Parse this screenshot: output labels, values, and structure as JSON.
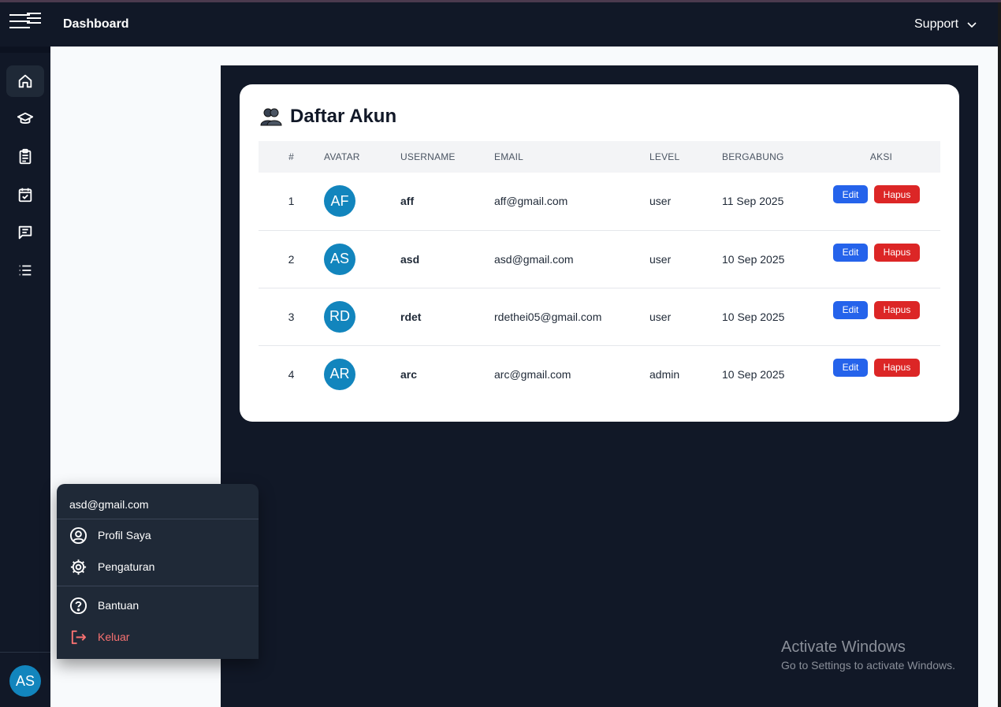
{
  "header": {
    "title": "Dashboard",
    "support_label": "Support"
  },
  "sidebar": {
    "items": [
      {
        "name": "home",
        "icon": "home-icon",
        "active": true
      },
      {
        "name": "courses",
        "icon": "graduation-cap-icon",
        "active": false
      },
      {
        "name": "assignments",
        "icon": "clipboard-icon",
        "active": false
      },
      {
        "name": "calendar",
        "icon": "calendar-check-icon",
        "active": false
      },
      {
        "name": "messages",
        "icon": "chat-icon",
        "active": false
      },
      {
        "name": "list",
        "icon": "list-icon",
        "active": false
      }
    ],
    "avatar_initials": "AS"
  },
  "card": {
    "title": "Daftar Akun",
    "columns": [
      "#",
      "AVATAR",
      "USERNAME",
      "EMAIL",
      "LEVEL",
      "BERGABUNG",
      "AKSI"
    ],
    "rows": [
      {
        "no": "1",
        "initials": "AF",
        "username": "aff",
        "email": "aff@gmail.com",
        "level": "user",
        "joined": "11 Sep 2025"
      },
      {
        "no": "2",
        "initials": "AS",
        "username": "asd",
        "email": "asd@gmail.com",
        "level": "user",
        "joined": "10 Sep 2025"
      },
      {
        "no": "3",
        "initials": "RD",
        "username": "rdet",
        "email": "rdethei05@gmail.com",
        "level": "user",
        "joined": "10 Sep 2025"
      },
      {
        "no": "4",
        "initials": "AR",
        "username": "arc",
        "email": "arc@gmail.com",
        "level": "admin",
        "joined": "10 Sep 2025"
      }
    ],
    "edit_label": "Edit",
    "delete_label": "Hapus"
  },
  "user_menu": {
    "email": "asd@gmail.com",
    "profile": "Profil Saya",
    "settings": "Pengaturan",
    "help": "Bantuan",
    "logout": "Keluar"
  },
  "watermark": {
    "line1": "Activate Windows",
    "line2": "Go to Settings to activate Windows."
  },
  "colors": {
    "dark_bg": "#111827",
    "avatar": "#1285bd",
    "edit": "#2563eb",
    "delete": "#dc2626",
    "logout": "#f87171"
  }
}
